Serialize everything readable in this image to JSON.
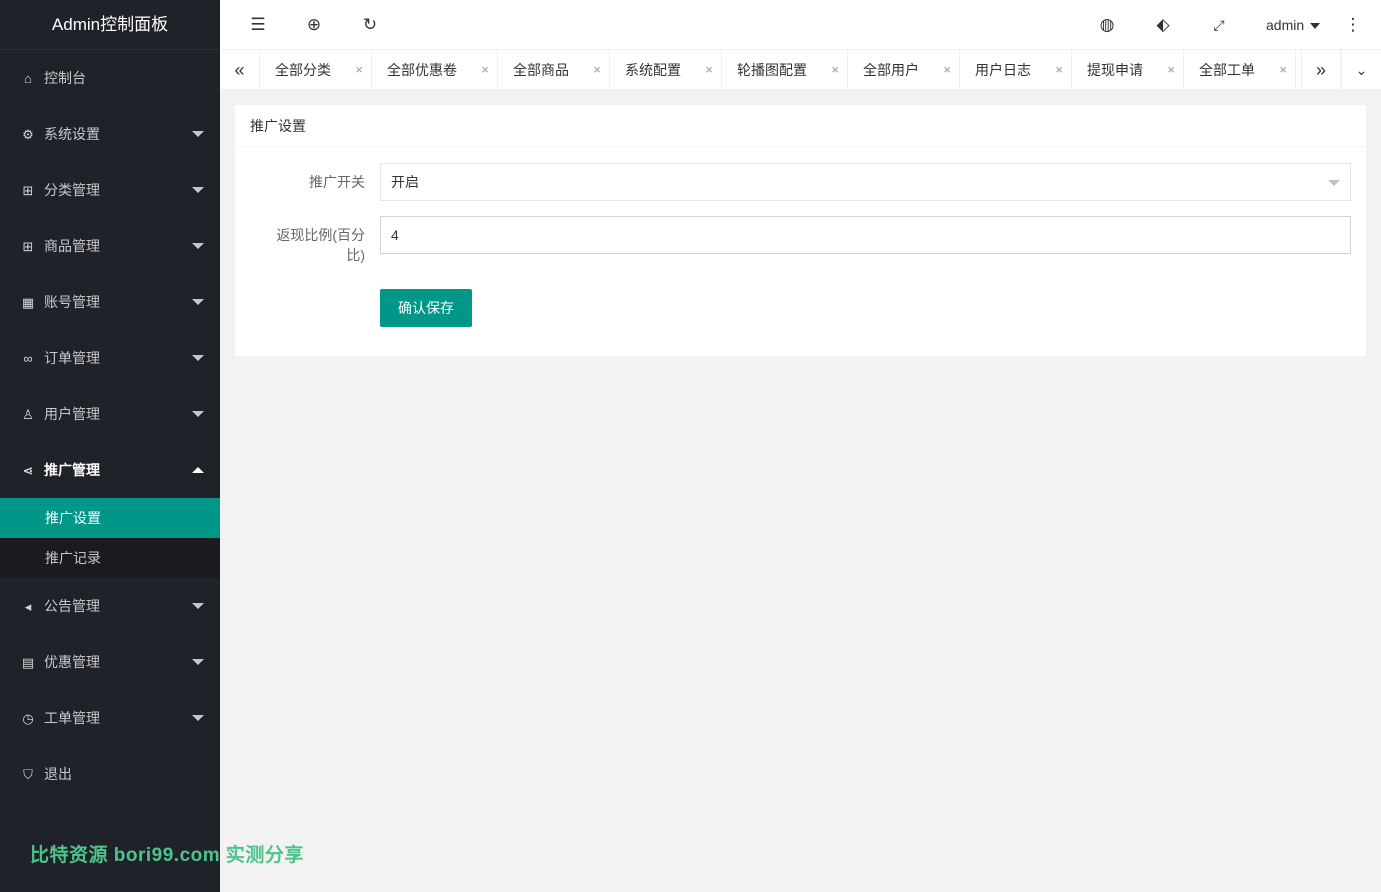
{
  "sidebar": {
    "logo": "Admin控制面板",
    "items": [
      {
        "label": "控制台",
        "icon": "home-icon"
      },
      {
        "label": "系统设置",
        "icon": "gear-icon"
      },
      {
        "label": "分类管理",
        "icon": "apps-icon"
      },
      {
        "label": "商品管理",
        "icon": "apps-icon"
      },
      {
        "label": "账号管理",
        "icon": "grid-icon"
      },
      {
        "label": "订单管理",
        "icon": "link-icon"
      },
      {
        "label": "用户管理",
        "icon": "user-icon"
      },
      {
        "label": "推广管理",
        "icon": "share-icon"
      },
      {
        "label": "公告管理",
        "icon": "speaker-icon"
      },
      {
        "label": "优惠管理",
        "icon": "calendar-icon"
      },
      {
        "label": "工单管理",
        "icon": "clock-icon"
      },
      {
        "label": "退出",
        "icon": "shield-icon"
      }
    ],
    "subitems": [
      {
        "label": "推广设置"
      },
      {
        "label": "推广记录"
      }
    ]
  },
  "watermark": "比特资源 bori99.com 实测分享",
  "header": {
    "user": "admin"
  },
  "tabs": [
    {
      "label": "全部分类"
    },
    {
      "label": "全部优惠卷"
    },
    {
      "label": "全部商品"
    },
    {
      "label": "系统配置"
    },
    {
      "label": "轮播图配置"
    },
    {
      "label": "全部用户"
    },
    {
      "label": "用户日志"
    },
    {
      "label": "提现申请"
    },
    {
      "label": "全部工单"
    }
  ],
  "card": {
    "title": "推广设置",
    "switch_label": "推广开关",
    "switch_value": "开启",
    "ratio_label": "返现比例(百分比)",
    "ratio_value": "4",
    "save_label": "确认保存"
  }
}
